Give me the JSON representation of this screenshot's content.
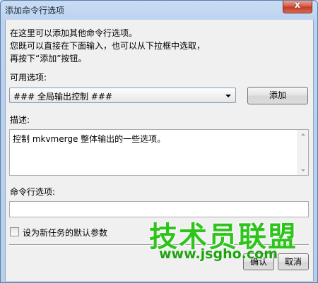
{
  "window": {
    "title": "添加命令行选项",
    "close_glyph": "x"
  },
  "intro_text": "在这里可以添加其他命令行选项。\n您既可以直接在下面输入，也可以从下拉框中选取，\n再按下“添加”按钮。",
  "available": {
    "label": "可用选项:",
    "selected": "### 全局输出控制 ###",
    "add_button": "添加"
  },
  "description": {
    "label": "描述:",
    "text": "控制 mkvmerge 整体输出的一些选项。"
  },
  "command_line": {
    "label": "命令行选项:",
    "value": ""
  },
  "default_checkbox": {
    "label": "设为新任务的默认参数",
    "checked": false
  },
  "footer": {
    "ok_button": "确认",
    "cancel_button": "取消"
  },
  "watermark": {
    "text": "技术员联盟",
    "url": "www.jsgho.com"
  },
  "colors": {
    "watermark": "#2ec41c",
    "close_button": "#c33a23"
  }
}
